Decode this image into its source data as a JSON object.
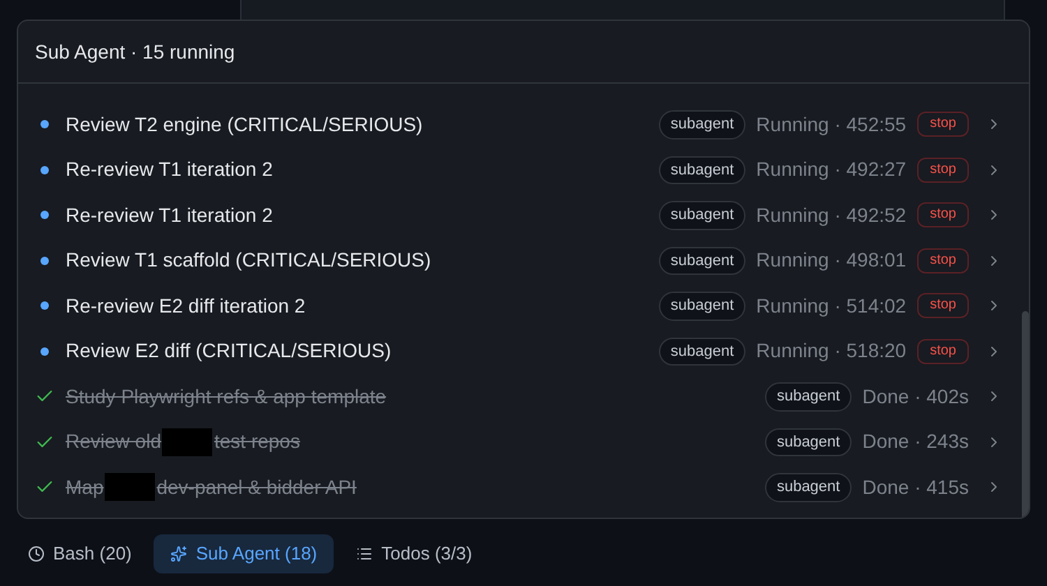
{
  "panel": {
    "title": "Sub Agent · 15 running"
  },
  "agents": [
    {
      "done": false,
      "segments": [
        {
          "kind": "text",
          "text": "Review T2 engine (CRITICAL/SERIOUS)"
        }
      ],
      "tag": "subagent",
      "state_text": "Running · 452:55",
      "stop": "stop"
    },
    {
      "done": false,
      "segments": [
        {
          "kind": "text",
          "text": "Re-review T1 iteration 2"
        }
      ],
      "tag": "subagent",
      "state_text": "Running · 492:27",
      "stop": "stop"
    },
    {
      "done": false,
      "segments": [
        {
          "kind": "text",
          "text": "Re-review T1 iteration 2"
        }
      ],
      "tag": "subagent",
      "state_text": "Running · 492:52",
      "stop": "stop"
    },
    {
      "done": false,
      "segments": [
        {
          "kind": "text",
          "text": "Review T1 scaffold (CRITICAL/SERIOUS)"
        }
      ],
      "tag": "subagent",
      "state_text": "Running · 498:01",
      "stop": "stop"
    },
    {
      "done": false,
      "segments": [
        {
          "kind": "text",
          "text": "Re-review E2 diff iteration 2"
        }
      ],
      "tag": "subagent",
      "state_text": "Running · 514:02",
      "stop": "stop"
    },
    {
      "done": false,
      "segments": [
        {
          "kind": "text",
          "text": "Review E2 diff (CRITICAL/SERIOUS)"
        }
      ],
      "tag": "subagent",
      "state_text": "Running · 518:20",
      "stop": "stop"
    },
    {
      "done": true,
      "segments": [
        {
          "kind": "text",
          "text": "Study Playwright refs & app template"
        }
      ],
      "tag": "subagent",
      "state_text": "Done · 402s"
    },
    {
      "done": true,
      "segments": [
        {
          "kind": "text",
          "text": "Review old"
        },
        {
          "kind": "redacted"
        },
        {
          "kind": "text",
          "text": "test repos"
        }
      ],
      "tag": "subagent",
      "state_text": "Done · 243s"
    },
    {
      "done": true,
      "segments": [
        {
          "kind": "text",
          "text": "Map"
        },
        {
          "kind": "redacted"
        },
        {
          "kind": "text",
          "text": "dev-panel & bidder API"
        }
      ],
      "tag": "subagent",
      "state_text": "Done · 415s"
    }
  ],
  "tabs": [
    {
      "kind": "clock",
      "label": "Bash",
      "count": "(20)",
      "selected": false
    },
    {
      "kind": "sparkle",
      "label": "Sub Agent",
      "count": "(18)",
      "selected": true
    },
    {
      "kind": "list",
      "label": "Todos",
      "count": "(3/3)",
      "selected": false
    }
  ]
}
